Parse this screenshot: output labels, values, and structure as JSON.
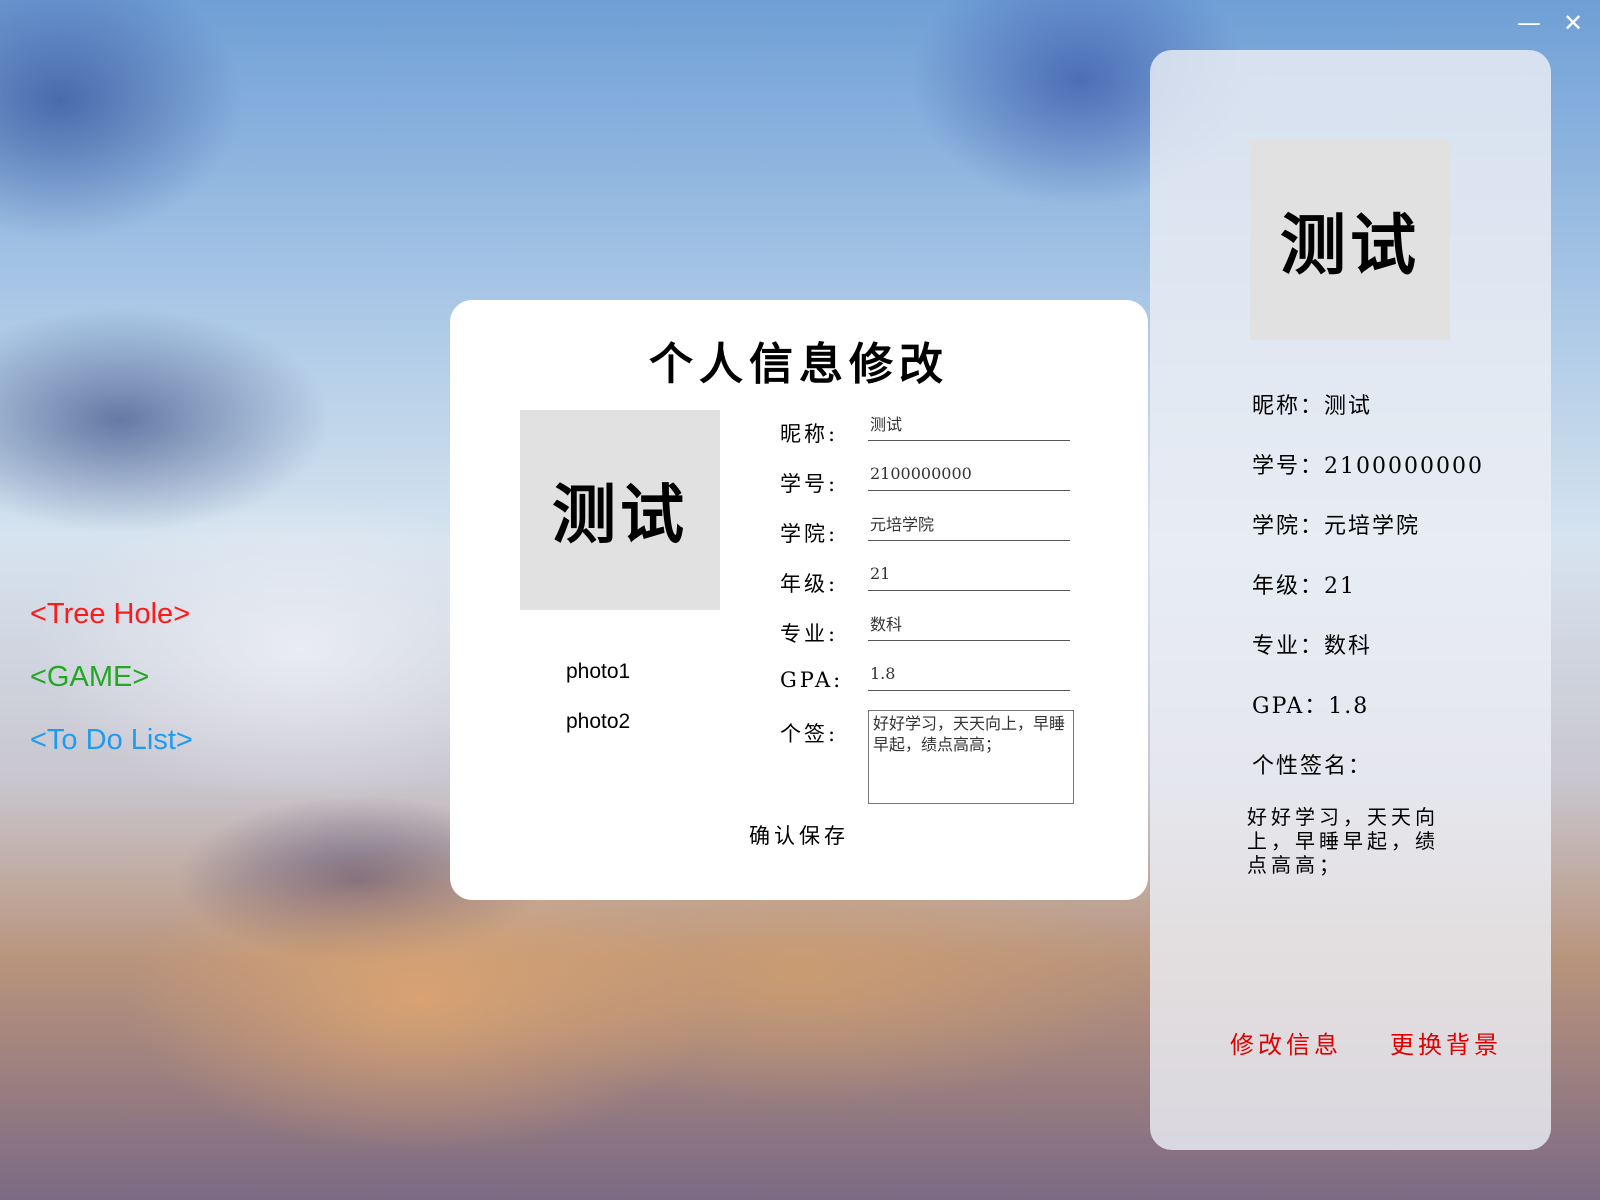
{
  "window": {
    "minimize_glyph": "—",
    "close_glyph": "✕"
  },
  "nav": {
    "tree_hole": {
      "label": "<Tree Hole>",
      "color": "#ff1a1a"
    },
    "game": {
      "label": "<GAME>",
      "color": "#22a822"
    },
    "todo": {
      "label": "<To Do List>",
      "color": "#1f9cf0"
    }
  },
  "edit_form": {
    "title": "个人信息修改",
    "avatar_text": "测试",
    "photo1": "photo1",
    "photo2": "photo2",
    "fields": {
      "nickname": {
        "label": "昵称:",
        "value": "测试"
      },
      "student_id": {
        "label": "学号:",
        "value": "2100000000"
      },
      "college": {
        "label": "学院:",
        "value": "元培学院"
      },
      "grade": {
        "label": "年级:",
        "value": "21"
      },
      "major": {
        "label": "专业:",
        "value": "数科"
      },
      "gpa": {
        "label": "GPA:",
        "value": "1.8"
      },
      "signature": {
        "label": "个签:",
        "value": "好好学习，天天向上，早睡早起，绩点高高；"
      }
    },
    "save_label": "确认保存"
  },
  "profile": {
    "avatar_text": "测试",
    "nickname": "昵称：测试",
    "student_id": "学号：2100000000",
    "college": "学院：元培学院",
    "grade": "年级：21",
    "major": "专业：数科",
    "gpa": "GPA：1.8",
    "signature_label": "个性签名：",
    "signature": "好好学习，天天向上，早睡早起，绩点高高；",
    "edit_label": "修改信息",
    "bg_label": "更换背景",
    "action_color": "#e00000"
  }
}
